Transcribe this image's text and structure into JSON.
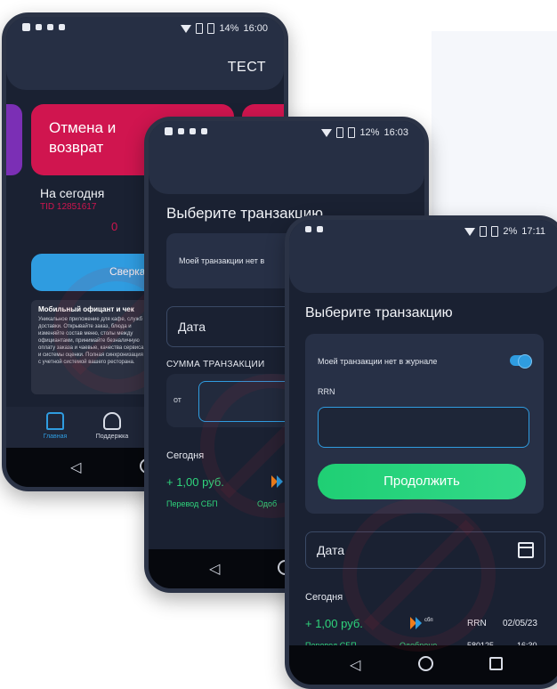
{
  "phone1": {
    "status": {
      "battery": "14%",
      "time": "16:00"
    },
    "header_title": "ТЕСТ",
    "card_label": "Отмена и возврат",
    "today_label": "На сегодня",
    "tid": "TID 12851617",
    "today_value": "0",
    "blue_button": "Сверка",
    "info": {
      "title": "Мобильный офицант и чек",
      "body": "Уникальное приложение для кафе, служб доставки. Открывайте заказ, блюда и изменяйте состав меню, столы между официантами, принимайте безналичную оплату заказа и чаевые, качества сервиса и системы оценки. Полная синхронизация с учетной системой вашего ресторана."
    },
    "tabs": [
      {
        "label": "Главная",
        "icon": "home-icon"
      },
      {
        "label": "Поддержка",
        "icon": "headset-icon"
      }
    ]
  },
  "phone2": {
    "status": {
      "battery": "12%",
      "time": "16:03"
    },
    "heading": "Выберите транзакцию",
    "toggle_label": "Моей транзакции нет в",
    "date_label": "Дата",
    "sum_label": "СУММА ТРАНЗАКЦИИ",
    "from_label": "от",
    "today_label": "Сегодня",
    "transaction": {
      "amount": "+ 1,00 руб.",
      "type": "Перевод СБП",
      "status": "Одоб"
    }
  },
  "phone3": {
    "status": {
      "battery": "2%",
      "time": "17:11"
    },
    "heading": "Выберите транзакцию",
    "toggle_label": "Моей транзакции нет в журнале",
    "toggle_on": true,
    "rrn_label": "RRN",
    "continue_button": "Продолжить",
    "date_label": "Дата",
    "today_label": "Сегодня",
    "transaction": {
      "amount": "+ 1,00 руб.",
      "type": "Перевод СБП",
      "status": "Одобрено",
      "rrn_label": "RRN",
      "rrn_value": "580125",
      "date": "02/05/23",
      "time": "16:30",
      "sbp_label": "сбп"
    }
  },
  "colors": {
    "background": "#1a2132",
    "accent_red": "#d0154f",
    "accent_blue": "#2f9ce0",
    "accent_green": "#2fd57c",
    "purple": "#7b2fb5"
  }
}
